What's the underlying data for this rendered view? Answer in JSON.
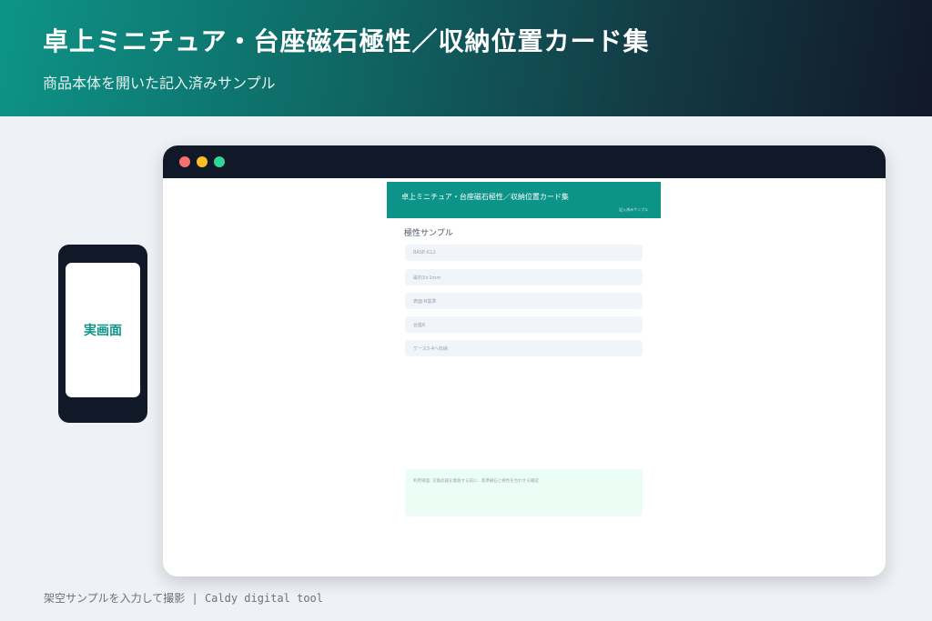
{
  "header": {
    "title": "卓上ミニチュア・台座磁石極性／収納位置カード集",
    "subtitle": "商品本体を開いた記入済みサンプル"
  },
  "phone": {
    "screen_label": "実画面"
  },
  "app": {
    "title": "卓上ミニチュア・台座磁石極性／収納位置カード集",
    "note": "記入済みサンプル",
    "section_title": "極性サンプル",
    "fields": [
      {
        "value": "BASE-K12"
      },
      {
        "value": "磁石3×1mm"
      },
      {
        "value": "表面:N基準"
      },
      {
        "value": "台座6"
      },
      {
        "value": "ケース3-4へ収納"
      }
    ],
    "memo": "利用場面: 交換武器を着脱する前に、基準磁石と極性を合わせる確認"
  },
  "footer": {
    "text": "架空サンプルを入力して撮影 | Caldy digital tool"
  },
  "colors": {
    "accent": "#0d9488",
    "dark": "#111827",
    "memo_bg": "#ecfdf5"
  }
}
